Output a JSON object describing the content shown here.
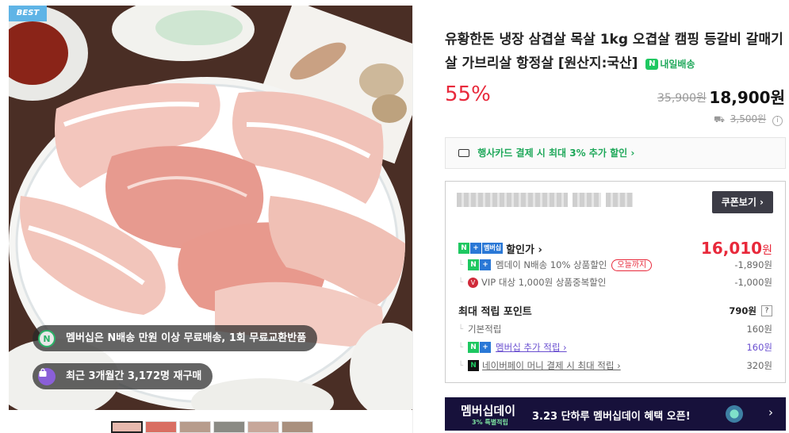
{
  "gallery": {
    "best_label": "BEST",
    "membership_pill": "멤버십은 N배송 만원 이상 무료배송, 1회 무료교환반품",
    "membership_icon": "N",
    "repurchase_pill": "최근 3개월간 3,172명 재구매",
    "repurchase_icon": "bag-icon"
  },
  "product": {
    "title": "유황한돈 냉장 삼겹살 목살 1kg 오겹살 캠핑 등갈비 갈매기살 가브리살 항정살 [원산지:국산]",
    "delivery_badge_n": "N",
    "delivery_badge": "내일배송",
    "discount": "55%",
    "original_price": "35,900원",
    "sale_price": "18,900원",
    "shipping_fee": "3,500원",
    "info_icon": "i"
  },
  "card_promo": {
    "text": "행사카드 결제 시 최대 3% 추가 할인 ›"
  },
  "coupon": {
    "button_label": "쿠폰보기 ›",
    "member_price_label": "할인가 ›",
    "member_badge": "멤버십",
    "final_price": "16,010",
    "final_unit": "원",
    "discounts": [
      {
        "label": "멤데이 N배송 10% 상품할인",
        "tag": "오늘까지",
        "value": "-1,890원"
      },
      {
        "label": "VIP 대상 1,000원 상품중복할인",
        "value": "-1,000원"
      }
    ],
    "points_title": "최대 적립 포인트",
    "points_total": "790원",
    "points_help": "?",
    "points": [
      {
        "label": "기본적립",
        "value": "160원"
      },
      {
        "label": "멤버십 추가 적립 ›",
        "value": "160원"
      },
      {
        "label": "네이버페이 머니 결제 시 최대 적립 ›",
        "value": "320원"
      }
    ]
  },
  "banner": {
    "title": "멤버십데이",
    "subtitle": "3% 특별적립",
    "message": "3.23 단하루 멤버십데이 혜택 오픈!",
    "arrow": "›"
  },
  "colors": {
    "accent_red": "#e8293b",
    "naver_green": "#1ec861",
    "banner_bg": "#17113b"
  }
}
